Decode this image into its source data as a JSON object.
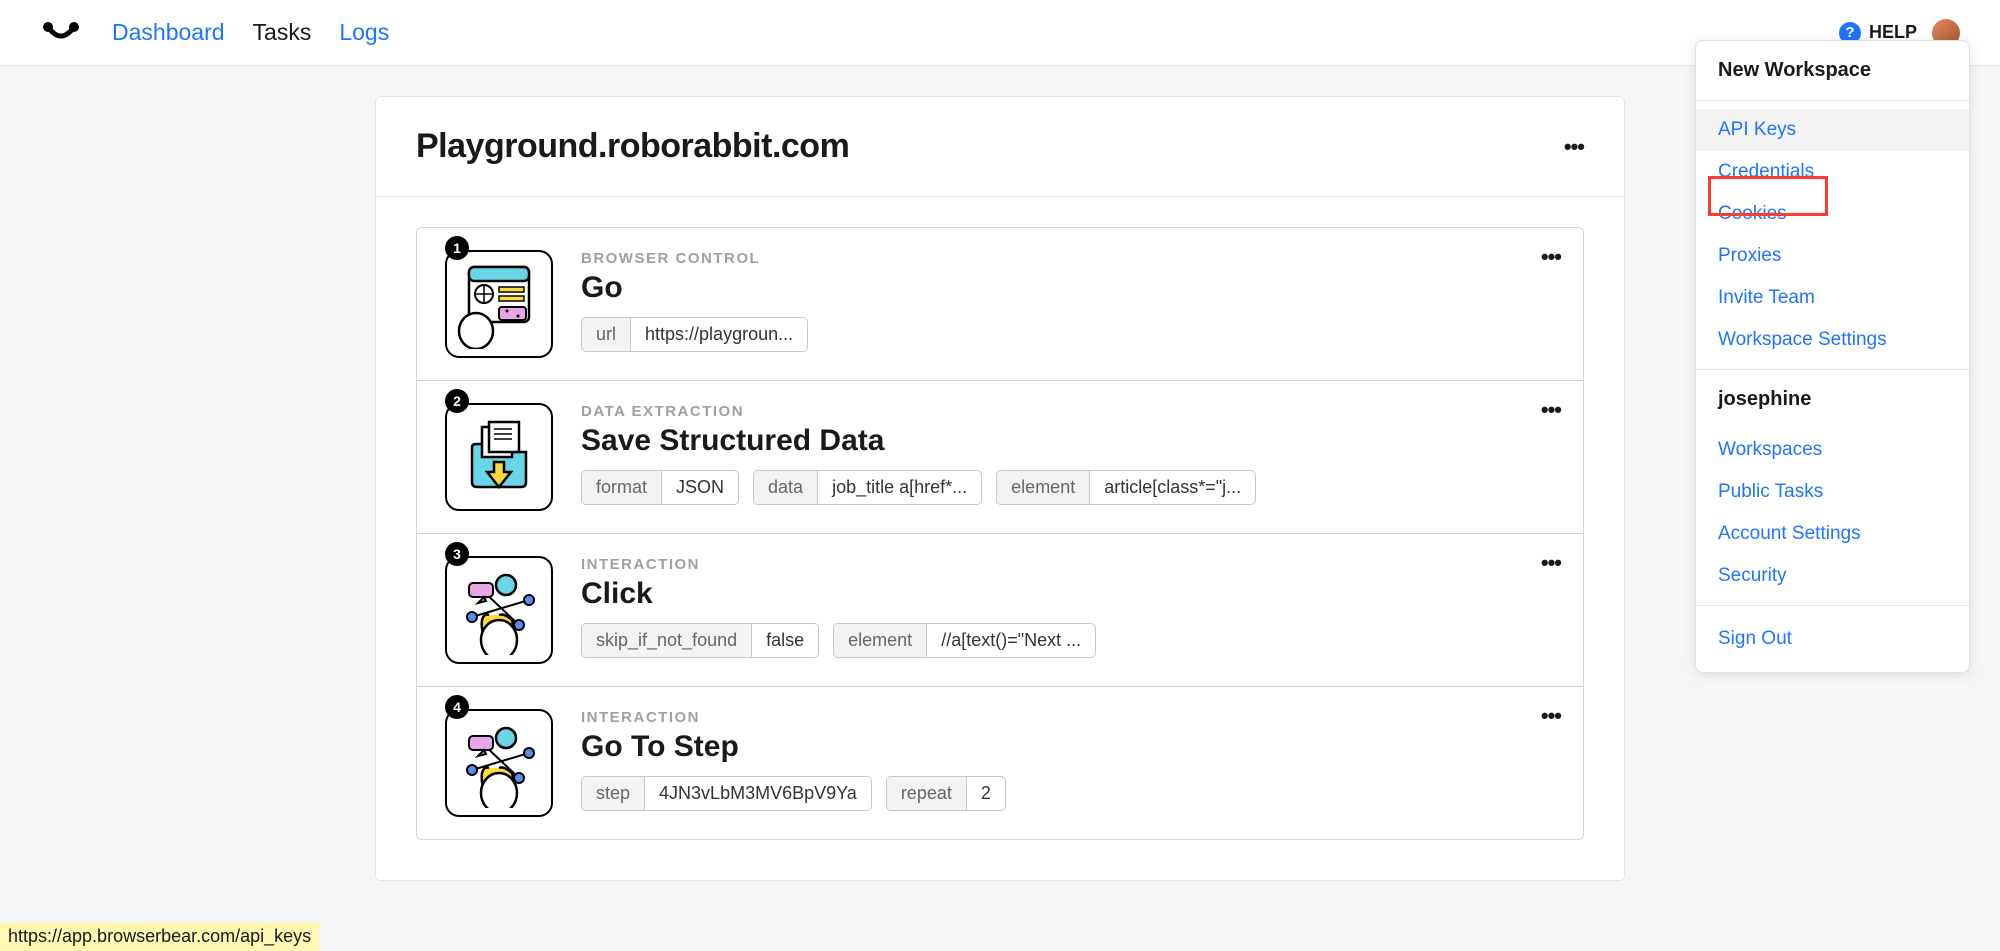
{
  "nav": {
    "dashboard": "Dashboard",
    "tasks": "Tasks",
    "logs": "Logs"
  },
  "help_label": "HELP",
  "page_title": "Playground.roborabbit.com",
  "steps": [
    {
      "num": "1",
      "category": "BROWSER CONTROL",
      "title": "Go",
      "tags": [
        {
          "key": "url",
          "val": "https://playgroun..."
        }
      ]
    },
    {
      "num": "2",
      "category": "DATA EXTRACTION",
      "title": "Save Structured Data",
      "tags": [
        {
          "key": "format",
          "val": "JSON"
        },
        {
          "key": "data",
          "val": "job_title a[href*..."
        },
        {
          "key": "element",
          "val": "article[class*=\"j..."
        }
      ]
    },
    {
      "num": "3",
      "category": "INTERACTION",
      "title": "Click",
      "tags": [
        {
          "key": "skip_if_not_found",
          "val": "false"
        },
        {
          "key": "element",
          "val": "//a[text()=\"Next ..."
        }
      ]
    },
    {
      "num": "4",
      "category": "INTERACTION",
      "title": "Go To Step",
      "tags": [
        {
          "key": "step",
          "val": "4JN3vLbM3MV6BpV9Ya"
        },
        {
          "key": "repeat",
          "val": "2"
        }
      ]
    }
  ],
  "dropdown": {
    "section1_title": "New Workspace",
    "section1_items": [
      "API Keys",
      "Credentials",
      "Cookies",
      "Proxies",
      "Invite Team",
      "Workspace Settings"
    ],
    "section2_title": "josephine",
    "section2_items": [
      "Workspaces",
      "Public Tasks",
      "Account Settings",
      "Security"
    ],
    "signout": "Sign Out"
  },
  "status_url": "https://app.browserbear.com/api_keys"
}
